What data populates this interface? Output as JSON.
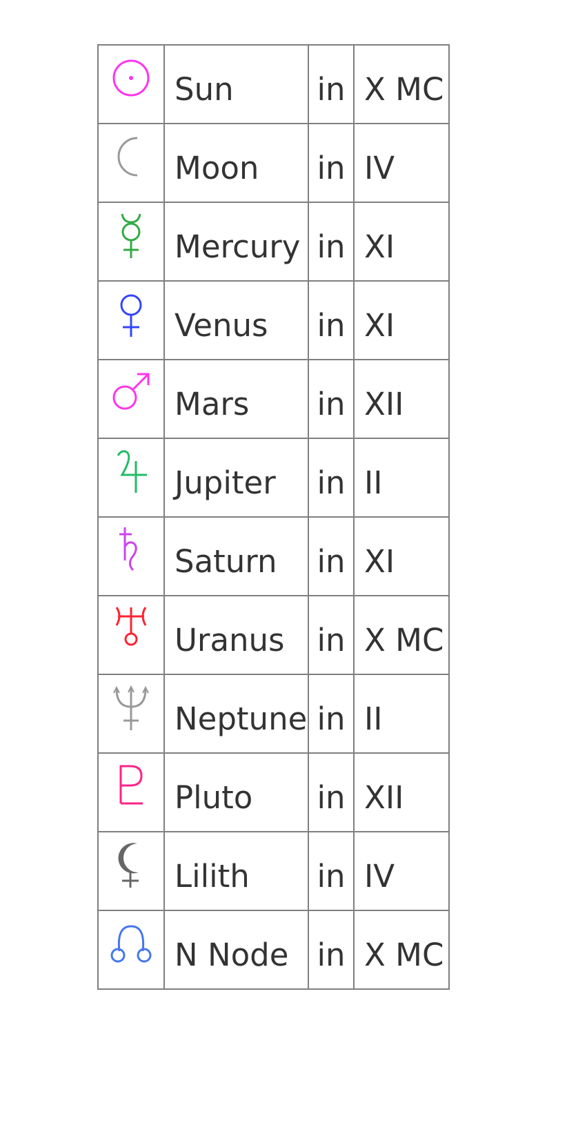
{
  "colors": {
    "sun": "#ff33ee",
    "moon": "#999999",
    "mercury": "#33aa44",
    "venus": "#3344ff",
    "mars": "#ff33ee",
    "jupiter": "#22bb66",
    "saturn": "#cc44ee",
    "uranus": "#ff2233",
    "neptune": "#999999",
    "pluto": "#ff2288",
    "lilith": "#666666",
    "nnode": "#4477ee"
  },
  "rows": [
    {
      "icon": "sun-icon",
      "planet": "Sun",
      "preposition": "in",
      "house": "X MC"
    },
    {
      "icon": "moon-icon",
      "planet": "Moon",
      "preposition": "in",
      "house": "IV"
    },
    {
      "icon": "mercury-icon",
      "planet": "Mercury",
      "preposition": "in",
      "house": "XI"
    },
    {
      "icon": "venus-icon",
      "planet": "Venus",
      "preposition": "in",
      "house": "XI"
    },
    {
      "icon": "mars-icon",
      "planet": "Mars",
      "preposition": "in",
      "house": "XII"
    },
    {
      "icon": "jupiter-icon",
      "planet": "Jupiter",
      "preposition": "in",
      "house": "II"
    },
    {
      "icon": "saturn-icon",
      "planet": "Saturn",
      "preposition": "in",
      "house": "XI"
    },
    {
      "icon": "uranus-icon",
      "planet": "Uranus",
      "preposition": "in",
      "house": "X MC"
    },
    {
      "icon": "neptune-icon",
      "planet": "Neptune",
      "preposition": "in",
      "house": "II"
    },
    {
      "icon": "pluto-icon",
      "planet": "Pluto",
      "preposition": "in",
      "house": "XII"
    },
    {
      "icon": "lilith-icon",
      "planet": "Lilith",
      "preposition": "in",
      "house": "IV"
    },
    {
      "icon": "north-node-icon",
      "planet": "N Node",
      "preposition": "in",
      "house": "X MC"
    }
  ]
}
